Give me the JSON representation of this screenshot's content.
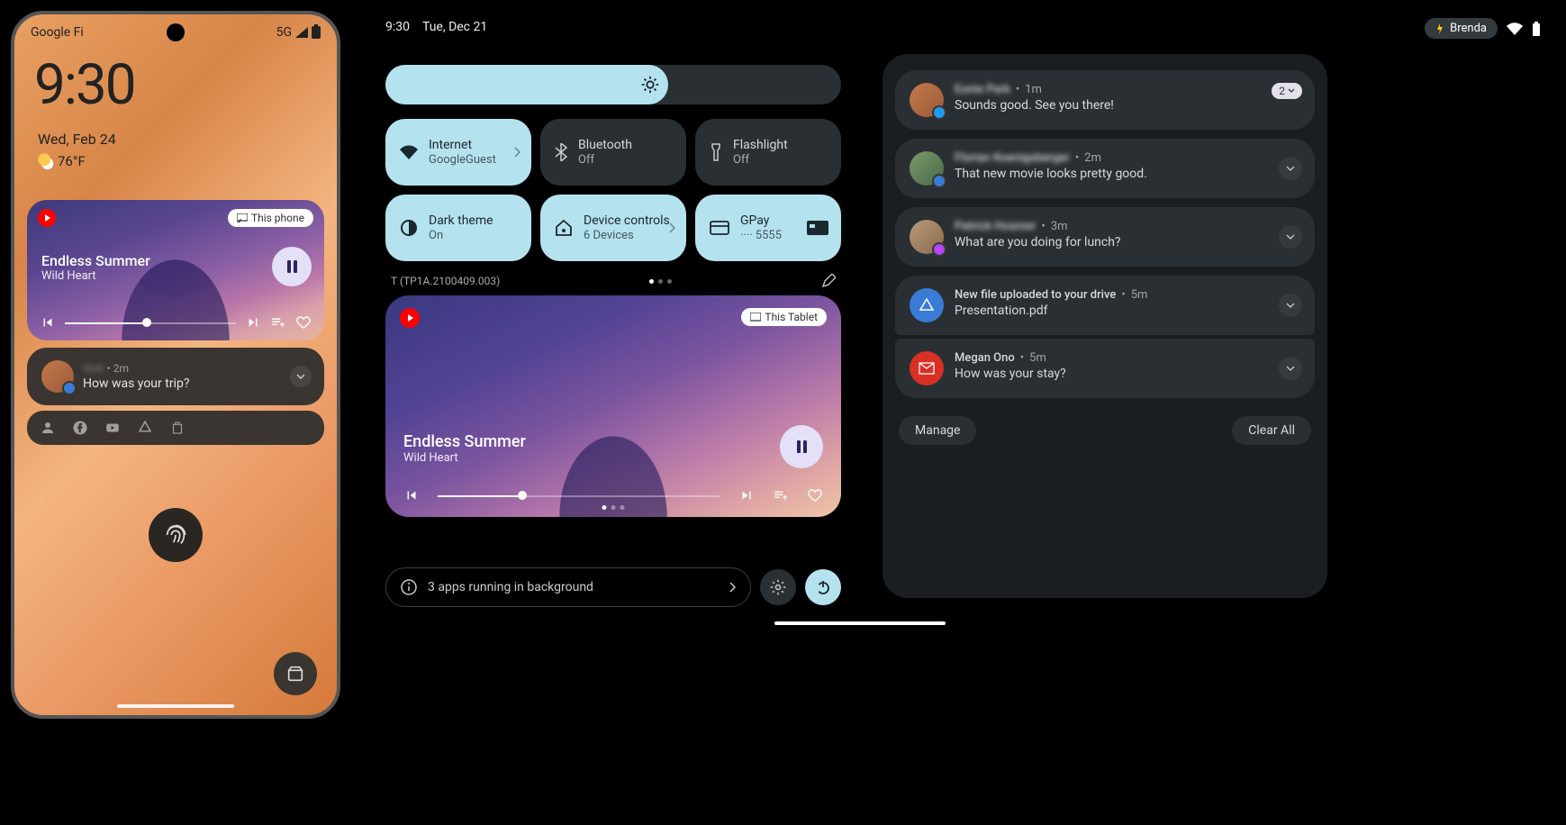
{
  "phone": {
    "carrier": "Google Fi",
    "network": "5G",
    "time": "9:30",
    "date": "Wed, Feb 24",
    "temperature": "76°F",
    "media": {
      "cast_label": "This phone",
      "title": "Endless Summer",
      "artist": "Wild Heart"
    },
    "notification": {
      "sender": "Alok",
      "time": "2m",
      "body": "How was your trip?"
    }
  },
  "tablet": {
    "time": "9:30",
    "date": "Tue, Dec 21",
    "user": "Brenda",
    "tiles": {
      "internet": {
        "label": "Internet",
        "sub": "GoogleGuest"
      },
      "bluetooth": {
        "label": "Bluetooth",
        "sub": "Off"
      },
      "flashlight": {
        "label": "Flashlight",
        "sub": "Off"
      },
      "darktheme": {
        "label": "Dark theme",
        "sub": "On"
      },
      "devicecontrols": {
        "label": "Device controls",
        "sub": "6 Devices"
      },
      "gpay": {
        "label": "GPay",
        "sub": "···· 5555"
      }
    },
    "build": "T (TP1A.2100409.003)",
    "media": {
      "cast_label": "This Tablet",
      "title": "Endless Summer",
      "artist": "Wild Heart"
    },
    "bg_apps": "3 apps running in background"
  },
  "notifications": {
    "items": [
      {
        "sender": "Eunie Park",
        "time": "1m",
        "body": "Sounds good. See you there!",
        "count": "2",
        "blurred": true,
        "avatar_badge": "twitter"
      },
      {
        "sender": "Florian Koenigsberger",
        "time": "2m",
        "body": "That new movie looks pretty good.",
        "blurred": true,
        "avatar_badge": "messages"
      },
      {
        "sender": "Patrick Hosmer",
        "time": "3m",
        "body": "What are you doing for lunch?",
        "blurred": true,
        "avatar_badge": "messenger"
      },
      {
        "sender": "New file uploaded to your drive",
        "time": "5m",
        "body": "Presentation.pdf",
        "blurred": false,
        "icon": "drive"
      },
      {
        "sender": "Megan Ono",
        "time": "5m",
        "body": "How was your stay?",
        "blurred": false,
        "icon": "gmail"
      }
    ],
    "manage": "Manage",
    "clear": "Clear All"
  }
}
